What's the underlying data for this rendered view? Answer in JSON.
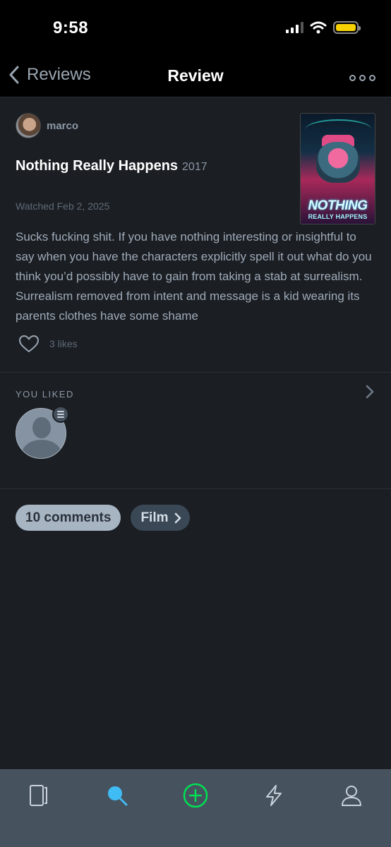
{
  "status_bar": {
    "time": "9:58"
  },
  "nav": {
    "back_label": "Reviews",
    "title": "Review"
  },
  "review": {
    "reviewer_name": "marco",
    "film_title": "Nothing Really Happens",
    "film_year": "2017",
    "watched": "Watched Feb 2, 2025",
    "poster_title": "NOTHING",
    "poster_subtitle": "REALLY HAPPENS",
    "body": "Sucks fucking shit. If you have nothing interesting or insightful to say when you have the characters explicitly spell it out what do you think you’d possibly have to gain from taking a stab at surrealism. Surrealism removed from intent and message is a kid wearing its parents clothes have some shame",
    "likes": "3 likes"
  },
  "you_liked": {
    "label": "YOU LIKED"
  },
  "pills": {
    "comments": "10 comments",
    "film": "Film"
  },
  "colors": {
    "background": "#1b1e23",
    "search_accent": "#40bcf4",
    "add_accent": "#00e054",
    "battery": "#f6d000"
  },
  "tab_bar": {
    "tabs": [
      "films-icon",
      "search-icon",
      "add-icon",
      "activity-icon",
      "profile-icon"
    ]
  }
}
